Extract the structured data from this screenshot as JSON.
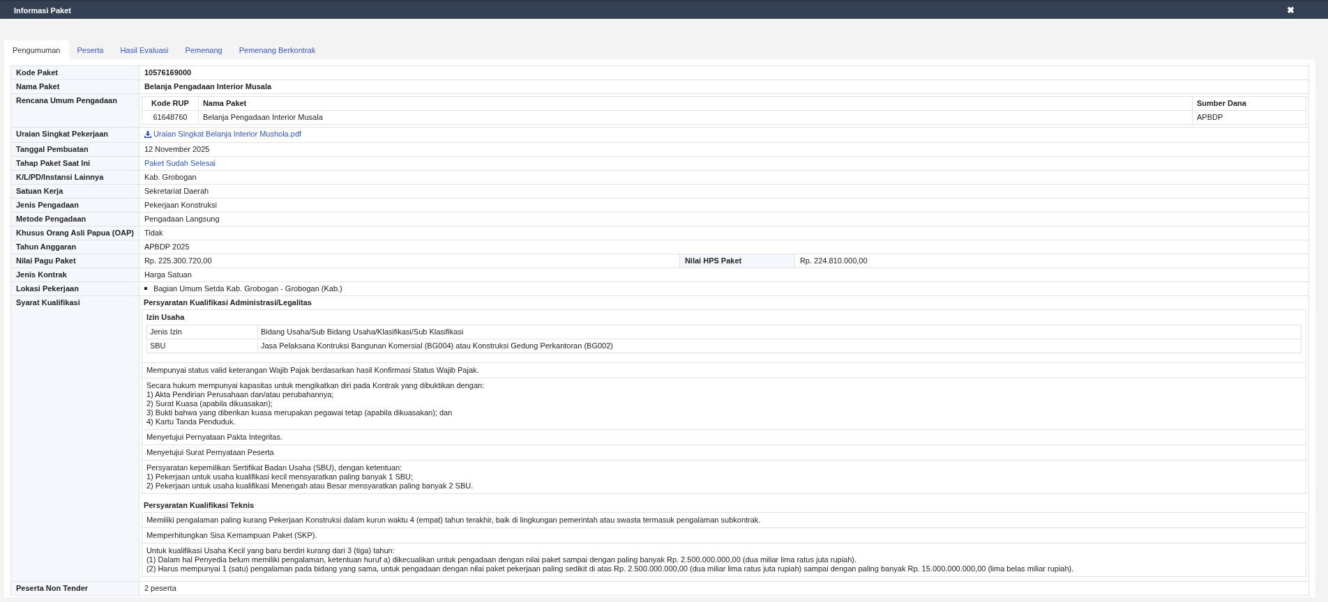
{
  "window": {
    "title": "Informasi Paket",
    "close": "✖"
  },
  "tabs": [
    {
      "label": "Pengumuman",
      "selected": true
    },
    {
      "label": "Peserta",
      "selected": false
    },
    {
      "label": "Hasil Evaluasi",
      "selected": false
    },
    {
      "label": "Pemenang",
      "selected": false
    },
    {
      "label": "Pemenang Berkontrak",
      "selected": false
    }
  ],
  "details": [
    {
      "kind": "bold",
      "label": "Kode Paket",
      "value": "10576169000"
    },
    {
      "kind": "bold",
      "label": "Nama Paket",
      "value": "Belanja Pengadaan Interior Musala"
    },
    {
      "kind": "rup",
      "label": "Rencana Umum Pengadaan",
      "columns": [
        "Kode RUP",
        "Nama Paket",
        "Sumber Dana"
      ],
      "rows": [
        [
          "61648760",
          "Belanja Pengadaan Interior Musala",
          "APBDP"
        ]
      ]
    },
    {
      "kind": "file",
      "label": "Uraian Singkat Pekerjaan",
      "value": "Uraian Singkat Belanja Interior Mushola.pdf"
    },
    {
      "kind": "text",
      "label": "Tanggal Pembuatan",
      "value": "12 November 2025"
    },
    {
      "kind": "link",
      "label": "Tahap Paket Saat Ini",
      "value": "Paket Sudah Selesai"
    },
    {
      "kind": "text",
      "label": "K/L/PD/Instansi Lainnya",
      "value": "Kab. Grobogan"
    },
    {
      "kind": "text",
      "label": "Satuan Kerja",
      "value": "Sekretariat Daerah"
    },
    {
      "kind": "text",
      "label": "Jenis Pengadaan",
      "value": "Pekerjaan Konstruksi"
    },
    {
      "kind": "text",
      "label": "Metode Pengadaan",
      "value": "Pengadaan Langsung"
    },
    {
      "kind": "text",
      "label": "Khusus Orang Asli Papua (OAP)",
      "value": "Tidak"
    },
    {
      "kind": "text",
      "label": "Tahun Anggaran",
      "value": "APBDP 2025"
    },
    {
      "kind": "pair",
      "label": "Nilai Pagu Paket",
      "value": "Rp. 225.300.720,00",
      "label2": "Nilai HPS Paket",
      "value2": "Rp. 224.810.000,00"
    },
    {
      "kind": "text",
      "label": "Jenis Kontrak",
      "value": "Harga Satuan"
    },
    {
      "kind": "list",
      "label": "Lokasi Pekerjaan",
      "items": [
        "Bagian Umum Setda Kab. Grobogan - Grobogan (Kab.)"
      ]
    },
    {
      "kind": "syarat",
      "label": "Syarat Kualifikasi",
      "sections": [
        {
          "title": "Persyaratan Kualifikasi Administrasi/Legalitas",
          "blocks": [
            {
              "kind": "izin",
              "title": "Izin Usaha",
              "columns": [
                "Jenis Izin",
                "Bidang Usaha/Sub Bidang Usaha/Klasifikasi/Sub Klasifikasi"
              ],
              "rows": [
                [
                  "SBU",
                  "Jasa Pelaksana Kontruksi Bangunan Komersial (BG004) atau Konstruksi Gedung Perkantoran (BG002)"
                ]
              ]
            },
            {
              "kind": "text",
              "lines": [
                "Mempunyai status valid keterangan Wajib Pajak berdasarkan hasil Konfirmasi Status Wajib Pajak."
              ]
            },
            {
              "kind": "text",
              "lines": [
                "Secara hukum mempunyai kapasitas untuk mengikatkan diri pada Kontrak yang dibuktikan dengan:",
                "1) Akta Pendirian Perusahaan dan/atau perubahannya;",
                "2) Surat Kuasa (apabila dikuasakan);",
                "3) Bukti bahwa yang diberikan kuasa merupakan pegawai tetap (apabila dikuasakan); dan",
                "4) Kartu Tanda Penduduk."
              ]
            },
            {
              "kind": "text",
              "lines": [
                "Menyetujui Pernyataan Pakta Integritas."
              ]
            },
            {
              "kind": "text",
              "lines": [
                "Menyetujui Surat Pernyataan Peserta"
              ]
            },
            {
              "kind": "text",
              "lines": [
                "Persyaratan kepemilikan Sertifikat Badan Usaha (SBU), dengan ketentuan:",
                "1) Pekerjaan untuk usaha kualifikasi kecil mensyaratkan paling banyak 1 SBU;",
                "2) Pekerjaan untuk usaha kualifikasi Menengah atau Besar mensyaratkan paling banyak 2 SBU."
              ]
            }
          ]
        },
        {
          "title": "Persyaratan Kualifikasi Teknis",
          "blocks": [
            {
              "kind": "text",
              "lines": [
                "Memiliki pengalaman paling kurang Pekerjaan Konstruksi dalam kurun waktu 4 (empat) tahun terakhir, baik di lingkungan pemerintah atau swasta termasuk pengalaman subkontrak."
              ]
            },
            {
              "kind": "text",
              "lines": [
                "Memperhitungkan Sisa Kemampuan Paket (SKP)."
              ]
            },
            {
              "kind": "text",
              "lines": [
                "Untuk kualifikasi Usaha Kecil yang baru berdiri kurang dari 3 (tiga) tahun:",
                "(1) Dalam hal Penyedia belum memiliki pengalaman, ketentuan huruf a) dikecualikan untuk pengadaan dengan nilai paket sampai dengan paling banyak Rp. 2.500.000.000,00 (dua miliar lima ratus juta rupiah).",
                "(2) Harus mempunyai 1 (satu) pengalaman pada bidang yang sama, untuk pengadaan dengan nilai paket pekerjaan paling sedikit di atas Rp. 2.500.000.000,00 (dua miliar lima ratus juta rupiah) sampai dengan paling banyak Rp. 15.000.000.000,00 (lima belas miliar rupiah)."
              ]
            }
          ]
        }
      ]
    },
    {
      "kind": "text",
      "label": "Peserta Non Tender",
      "value": "2 peserta"
    }
  ]
}
